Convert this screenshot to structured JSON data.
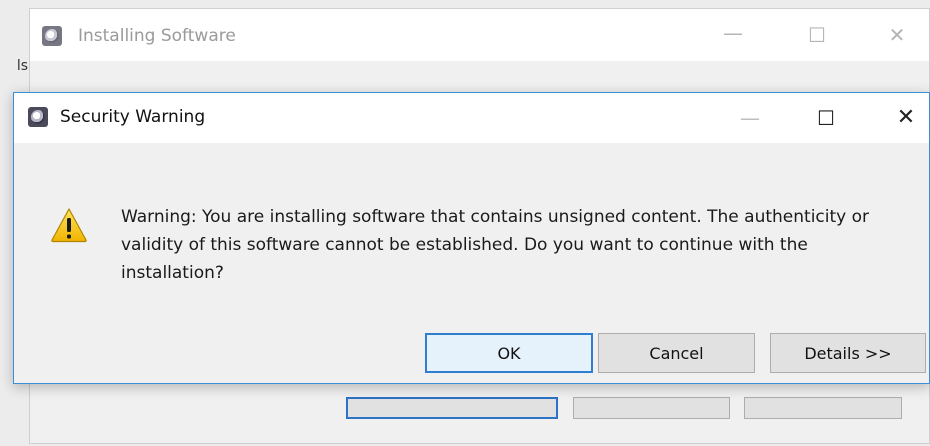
{
  "background_window": {
    "title": "Installing Software",
    "icon": "eclipse-app-icon",
    "controls": {
      "minimize": "—",
      "maximize": "☐",
      "close": "✕"
    },
    "fragment_label": "ls"
  },
  "dialog": {
    "title": "Security Warning",
    "icon": "eclipse-app-icon",
    "controls": {
      "minimize": "—",
      "maximize": "☐",
      "close": "✕"
    },
    "message": "Warning: You are installing software that contains unsigned content. The authenticity or validity of this software cannot be established. Do you want to continue with the installation?",
    "message_icon": "warning-triangle-icon",
    "buttons": {
      "ok": "OK",
      "cancel": "Cancel",
      "details": "Details >>"
    }
  },
  "colors": {
    "accent_border": "#3b8fd8",
    "default_button_border": "#2f7fd1",
    "warning_yellow": "#f5c400"
  }
}
